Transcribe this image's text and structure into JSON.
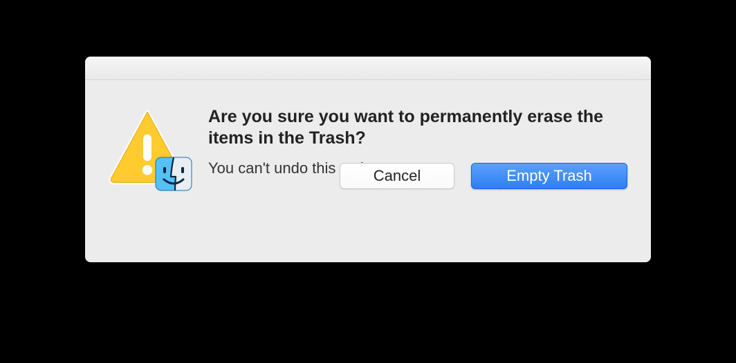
{
  "dialog": {
    "heading": "Are you sure you want to permanently erase the items in the Trash?",
    "subtext": "You can't undo this action.",
    "icons": {
      "alert": "alert-triangle-icon",
      "badge": "finder-icon"
    },
    "buttons": {
      "cancel": "Cancel",
      "confirm": "Empty Trash"
    },
    "colors": {
      "primary": "#2f7df0",
      "warning_fill": "#ffcb2e",
      "warning_stroke": "#e7b21e",
      "finder_left": "#56c0f2",
      "finder_right": "#e9eef3"
    }
  }
}
